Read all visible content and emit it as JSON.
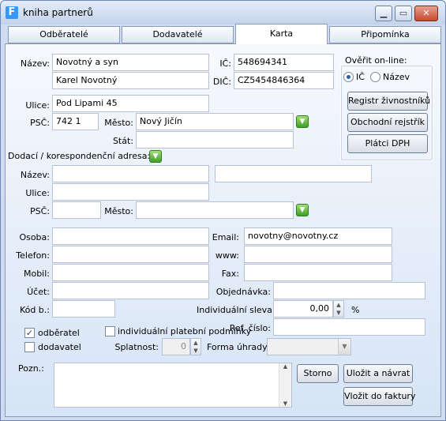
{
  "window": {
    "title": "kniha partnerů",
    "app_icon_letter": "F"
  },
  "tabs": [
    {
      "label": "Odběratelé"
    },
    {
      "label": "Dodavatelé"
    },
    {
      "label": "Karta"
    },
    {
      "label": "Připomínka"
    }
  ],
  "form": {
    "nazev_label": "Název:",
    "nazev1": "Novotný a syn",
    "nazev2": "Karel Novotný",
    "ulice_label": "Ulice:",
    "ulice": "Pod Lipami 45",
    "psc_label": "PSČ:",
    "psc": "742 1",
    "mesto_label": "Město:",
    "mesto": "Nový Jičín",
    "stat_label": "Stát:",
    "stat": "",
    "ic_label": "IČ:",
    "ic": "548694341",
    "dic_label": "DIČ:",
    "dic": "CZ5454846364"
  },
  "verify": {
    "title": "Ověřit on-line:",
    "radio_ic": "IČ",
    "radio_nazev": "Název",
    "btn_zivnost": "Registr živnostníků",
    "btn_obchodni": "Obchodní rejstřík",
    "btn_dph": "Plátci DPH"
  },
  "delivery": {
    "title": "Dodací / korespondenční adresa:",
    "nazev_label": "Název:",
    "ulice_label": "Ulice:",
    "psc_label": "PSČ:",
    "mesto_label": "Město:"
  },
  "contact": {
    "osoba_label": "Osoba:",
    "telefon_label": "Telefon:",
    "mobil_label": "Mobil:",
    "ucet_label": "Účet:",
    "kod_label": "Kód b.:",
    "email_label": "Email:",
    "email": "novotny@novotny.cz",
    "www_label": "www:",
    "fax_label": "Fax:",
    "objednavka_label": "Objednávka:",
    "sleva_label": "Individuální sleva:",
    "sleva": "0,00",
    "sleva_unit": "%",
    "ref_label": "Ref. číslo:"
  },
  "options": {
    "odberatel": "odběratel",
    "dodavatel": "dodavatel",
    "indiv": "individuální platební podmínky",
    "splatnost_label": "Splatnost:",
    "splatnost": "0",
    "forma_label": "Forma úhrady:",
    "pozn_label": "Pozn.:"
  },
  "buttons": {
    "storno": "Storno",
    "ulozit": "Uložit a návrat",
    "vlozit": "Vložit do faktury"
  }
}
